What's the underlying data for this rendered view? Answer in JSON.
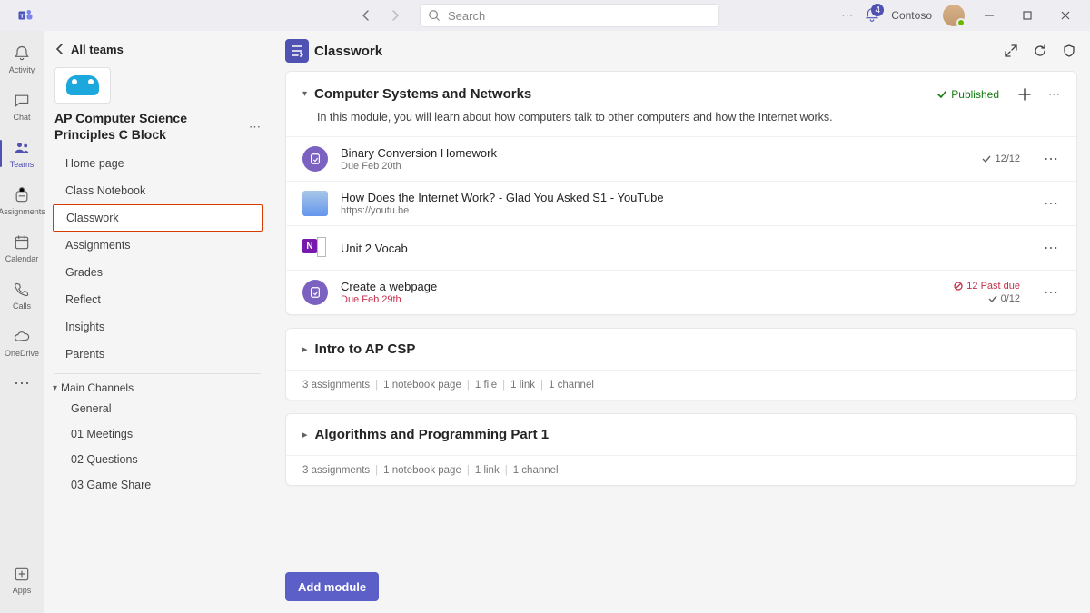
{
  "titlebar": {
    "search_placeholder": "Search",
    "org_label": "Contoso",
    "notification_count": "4"
  },
  "rail": {
    "items": [
      {
        "label": "Activity"
      },
      {
        "label": "Chat"
      },
      {
        "label": "Teams"
      },
      {
        "label": "Assignments"
      },
      {
        "label": "Calendar"
      },
      {
        "label": "Calls"
      },
      {
        "label": "OneDrive"
      }
    ],
    "apps_label": "Apps"
  },
  "panel": {
    "back_label": "All teams",
    "team_name": "AP Computer Science Principles C Block",
    "nav": [
      {
        "label": "Home page"
      },
      {
        "label": "Class Notebook"
      },
      {
        "label": "Classwork"
      },
      {
        "label": "Assignments"
      },
      {
        "label": "Grades"
      },
      {
        "label": "Reflect"
      },
      {
        "label": "Insights"
      },
      {
        "label": "Parents"
      }
    ],
    "section_label": "Main Channels",
    "channels": [
      {
        "label": "General"
      },
      {
        "label": "01 Meetings"
      },
      {
        "label": "02 Questions"
      },
      {
        "label": "03 Game Share"
      }
    ]
  },
  "page": {
    "title": "Classwork"
  },
  "modules": [
    {
      "title": "Computer Systems and Networks",
      "desc": "In this module, you will learn about how computers talk to other computers and how the Internet works.",
      "published_label": "Published",
      "resources": [
        {
          "title": "Binary Conversion Homework",
          "sub": "Due Feb 20th",
          "right_count": "12/12"
        },
        {
          "title": "How Does the Internet Work? - Glad You Asked S1 - YouTube",
          "sub": "https://youtu.be"
        },
        {
          "title": "Unit 2 Vocab"
        },
        {
          "title": "Create a webpage",
          "sub": "Due Feb 29th",
          "past_due_label": "12 Past due",
          "right_count": "0/12"
        }
      ]
    }
  ],
  "collapsed": [
    {
      "title": "Intro to AP CSP",
      "summary": [
        "3 assignments",
        "1 notebook page",
        "1 file",
        "1 link",
        "1 channel"
      ]
    },
    {
      "title": "Algorithms and Programming Part 1",
      "summary": [
        "3 assignments",
        "1 notebook page",
        "1 link",
        "1 channel"
      ]
    }
  ],
  "footer": {
    "add_module_label": "Add module"
  }
}
